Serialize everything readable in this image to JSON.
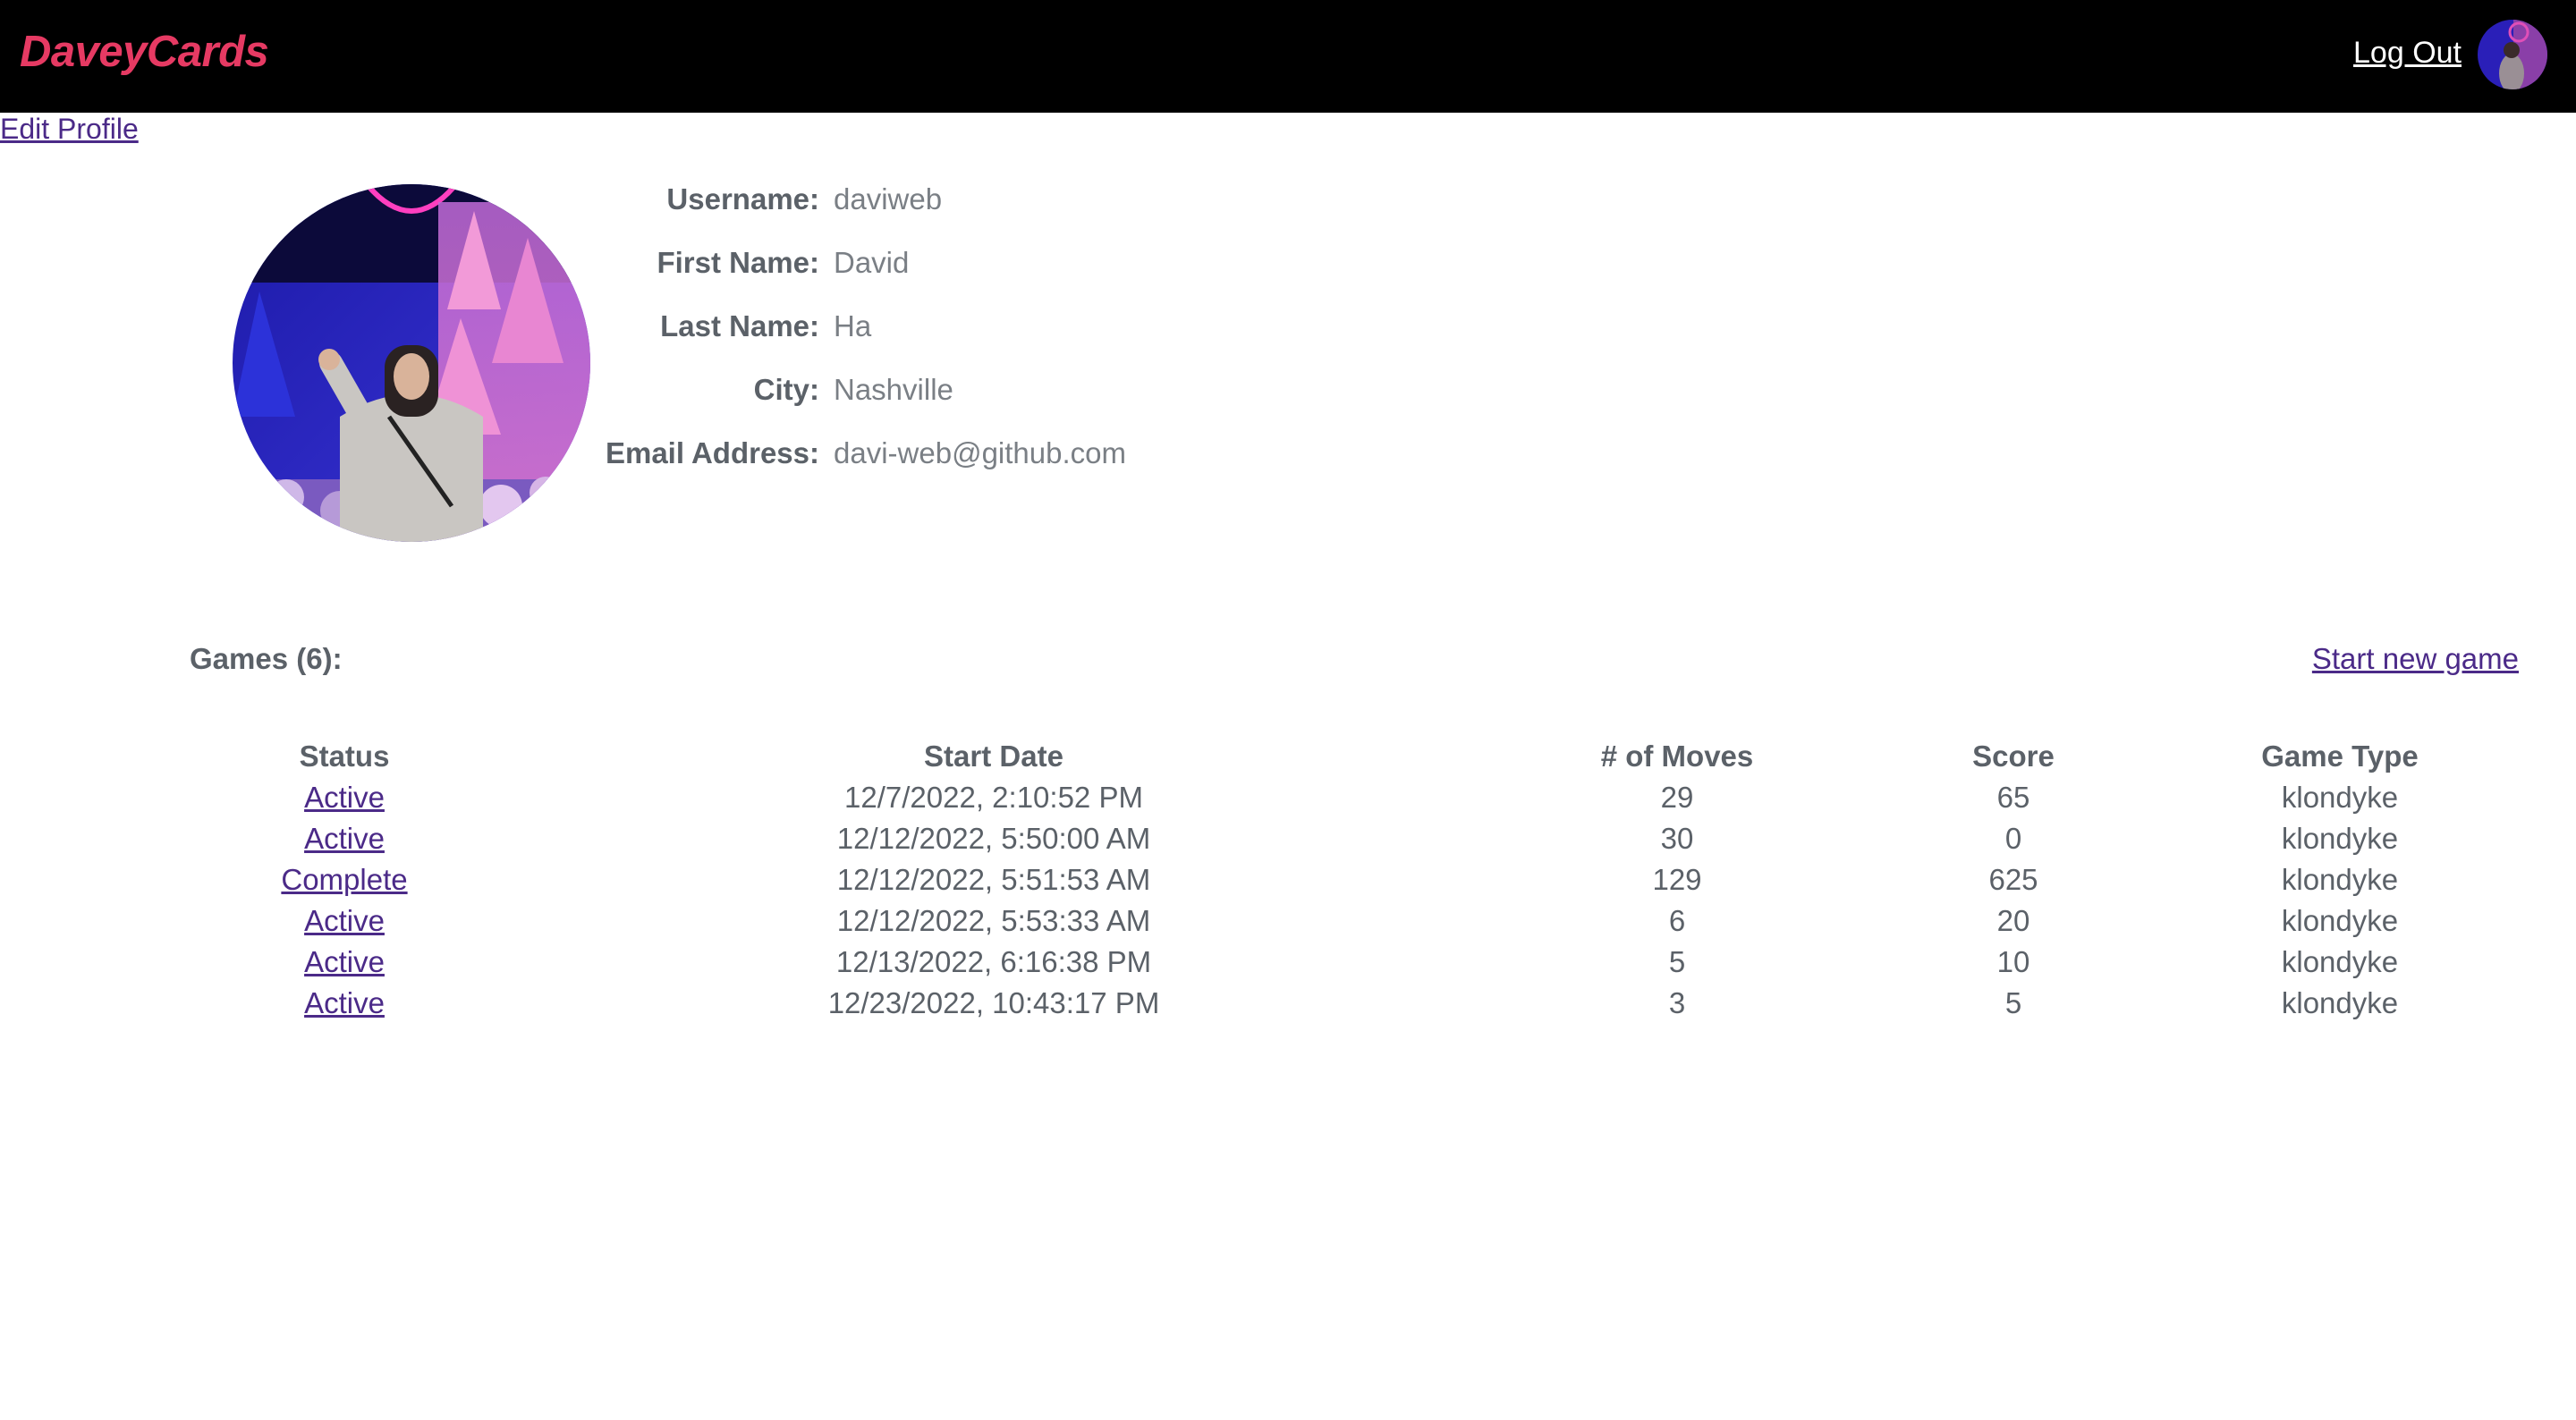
{
  "header": {
    "brand": "DaveyCards",
    "logout_label": "Log Out",
    "brand_color": "#e63a63",
    "background_color": "#000000"
  },
  "edit_profile_label": "Edit Profile",
  "profile": {
    "fields": [
      {
        "label": "Username:",
        "value": "daviweb"
      },
      {
        "label": "First Name:",
        "value": "David"
      },
      {
        "label": "Last Name:",
        "value": "Ha"
      },
      {
        "label": "City:",
        "value": "Nashville"
      },
      {
        "label": "Email Address:",
        "value": "davi-web@github.com"
      }
    ]
  },
  "games": {
    "title": "Games (6):",
    "new_game_label": "Start new game",
    "columns": [
      "Status",
      "Start Date",
      "# of Moves",
      "Score",
      "Game Type"
    ],
    "rows": [
      {
        "status": "Active",
        "start_date": "12/7/2022, 2:10:52 PM",
        "moves": "29",
        "score": "65",
        "type": "klondyke"
      },
      {
        "status": "Active",
        "start_date": "12/12/2022, 5:50:00 AM",
        "moves": "30",
        "score": "0",
        "type": "klondyke"
      },
      {
        "status": "Complete",
        "start_date": "12/12/2022, 5:51:53 AM",
        "moves": "129",
        "score": "625",
        "type": "klondyke"
      },
      {
        "status": "Active",
        "start_date": "12/12/2022, 5:53:33 AM",
        "moves": "6",
        "score": "20",
        "type": "klondyke"
      },
      {
        "status": "Active",
        "start_date": "12/13/2022, 6:16:38 PM",
        "moves": "5",
        "score": "10",
        "type": "klondyke"
      },
      {
        "status": "Active",
        "start_date": "12/23/2022, 10:43:17 PM",
        "moves": "3",
        "score": "5",
        "type": "klondyke"
      }
    ]
  }
}
